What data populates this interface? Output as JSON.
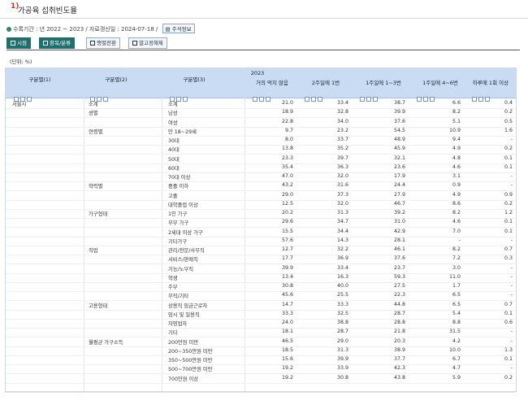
{
  "title": "가공육 섭취빈도율",
  "title_mark": "1)",
  "meta": {
    "period": "수록기간 : 년 2022 ~ 2023 / 자료갱신일 : 2024-07-18 /",
    "note_button": "주석정보"
  },
  "toolbar": [
    "시점",
    "항목/분류",
    "행렬전환",
    "열고정해제"
  ],
  "unit": "(단위: %)",
  "headers": {
    "col1": "구분별(1)",
    "col2": "구분별(2)",
    "col3": "구분별(3)",
    "year": "2023",
    "values": [
      "거의 먹지 않음",
      "2주일에 1번",
      "1주일에 1~3번",
      "1주일에 4~6번",
      "하루에 1회 이상"
    ]
  },
  "rows": [
    {
      "c1": "서울시",
      "c2": "소계",
      "c3": "소계",
      "v": [
        "21.0",
        "33.4",
        "38.7",
        "6.6",
        "0.4"
      ]
    },
    {
      "c1": "",
      "c2": "성별",
      "c3": "남성",
      "v": [
        "18.9",
        "32.8",
        "39.9",
        "8.2",
        "0.2"
      ]
    },
    {
      "c1": "",
      "c2": "",
      "c3": "여성",
      "v": [
        "22.8",
        "34.0",
        "37.6",
        "5.1",
        "0.5"
      ]
    },
    {
      "c1": "",
      "c2": "연령별",
      "c3": "만 18~29세",
      "v": [
        "9.7",
        "23.2",
        "54.5",
        "10.9",
        "1.6"
      ]
    },
    {
      "c1": "",
      "c2": "",
      "c3": "30대",
      "v": [
        "8.0",
        "33.7",
        "48.9",
        "9.4",
        "-"
      ]
    },
    {
      "c1": "",
      "c2": "",
      "c3": "40대",
      "v": [
        "13.8",
        "35.2",
        "45.9",
        "4.9",
        "0.2"
      ]
    },
    {
      "c1": "",
      "c2": "",
      "c3": "50대",
      "v": [
        "23.3",
        "39.7",
        "32.1",
        "4.8",
        "0.1"
      ]
    },
    {
      "c1": "",
      "c2": "",
      "c3": "60대",
      "v": [
        "35.4",
        "36.3",
        "23.6",
        "4.6",
        "0.1"
      ]
    },
    {
      "c1": "",
      "c2": "",
      "c3": "70대 이상",
      "v": [
        "47.0",
        "32.0",
        "17.9",
        "3.1",
        "-"
      ]
    },
    {
      "c1": "",
      "c2": "학력별",
      "c3": "중졸 이하",
      "v": [
        "43.2",
        "31.6",
        "24.4",
        "0.9",
        "-"
      ]
    },
    {
      "c1": "",
      "c2": "",
      "c3": "고졸",
      "v": [
        "29.0",
        "37.3",
        "27.9",
        "4.9",
        "0.9"
      ]
    },
    {
      "c1": "",
      "c2": "",
      "c3": "대학졸업 이상",
      "v": [
        "12.5",
        "32.0",
        "46.7",
        "8.6",
        "0.2"
      ]
    },
    {
      "c1": "",
      "c2": "가구형태",
      "c3": "1인 가구",
      "v": [
        "20.2",
        "31.3",
        "39.2",
        "8.2",
        "1.2"
      ]
    },
    {
      "c1": "",
      "c2": "",
      "c3": "부부 가구",
      "v": [
        "29.6",
        "34.7",
        "31.0",
        "4.6",
        "0.1"
      ]
    },
    {
      "c1": "",
      "c2": "",
      "c3": "2세대 이상 가구",
      "v": [
        "15.5",
        "34.4",
        "42.9",
        "7.0",
        "0.1"
      ]
    },
    {
      "c1": "",
      "c2": "",
      "c3": "기타가구",
      "v": [
        "57.6",
        "14.3",
        "28.1",
        "-",
        "-"
      ]
    },
    {
      "c1": "",
      "c2": "직업",
      "c3": "관리/전문/사무직",
      "v": [
        "12.7",
        "32.2",
        "46.1",
        "8.2",
        "0.7"
      ]
    },
    {
      "c1": "",
      "c2": "",
      "c3": "서비스/판매직",
      "v": [
        "17.7",
        "36.9",
        "37.6",
        "7.2",
        "0.3"
      ]
    },
    {
      "c1": "",
      "c2": "",
      "c3": "기능/노무직",
      "v": [
        "39.9",
        "33.4",
        "23.7",
        "3.0",
        "-"
      ]
    },
    {
      "c1": "",
      "c2": "",
      "c3": "학생",
      "v": [
        "13.4",
        "16.3",
        "59.3",
        "11.0",
        "-"
      ]
    },
    {
      "c1": "",
      "c2": "",
      "c3": "주부",
      "v": [
        "30.8",
        "40.0",
        "27.5",
        "1.7",
        "-"
      ]
    },
    {
      "c1": "",
      "c2": "",
      "c3": "무직/기타",
      "v": [
        "45.6",
        "25.5",
        "22.3",
        "6.5",
        "-"
      ]
    },
    {
      "c1": "",
      "c2": "고용형태",
      "c3": "상용직 임금근로자",
      "v": [
        "14.7",
        "33.3",
        "44.8",
        "6.5",
        "0.7"
      ]
    },
    {
      "c1": "",
      "c2": "",
      "c3": "임시 및 일용직",
      "v": [
        "33.3",
        "32.5",
        "28.7",
        "5.4",
        "0.1"
      ]
    },
    {
      "c1": "",
      "c2": "",
      "c3": "자영업자",
      "v": [
        "24.0",
        "38.8",
        "28.8",
        "8.8",
        "0.6"
      ]
    },
    {
      "c1": "",
      "c2": "",
      "c3": "기타",
      "v": [
        "18.1",
        "28.7",
        "21.8",
        "31.5",
        "-"
      ]
    },
    {
      "c1": "",
      "c2": "월평균 가구소득",
      "c3": "200만원 미만",
      "v": [
        "46.5",
        "29.0",
        "20.3",
        "4.2",
        "-"
      ]
    },
    {
      "c1": "",
      "c2": "",
      "c3": "200~350만원 미만",
      "v": [
        "18.5",
        "31.3",
        "38.9",
        "10.0",
        "1.3"
      ]
    },
    {
      "c1": "",
      "c2": "",
      "c3": "350~500만원 미만",
      "v": [
        "15.6",
        "39.9",
        "37.7",
        "6.7",
        "0.1"
      ]
    },
    {
      "c1": "",
      "c2": "",
      "c3": "500~700만원 미만",
      "v": [
        "19.2",
        "33.9",
        "42.3",
        "4.7",
        "-"
      ]
    },
    {
      "c1": "",
      "c2": "",
      "c3": "700만원 이상",
      "v": [
        "19.2",
        "30.8",
        "43.8",
        "5.9",
        "0.2"
      ]
    }
  ]
}
